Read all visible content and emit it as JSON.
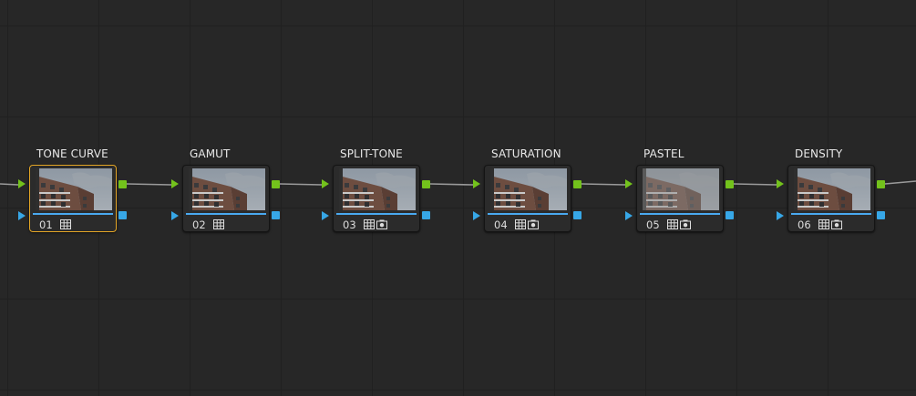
{
  "nodes": [
    {
      "label": "TONE CURVE",
      "number": "01",
      "icons": [
        "grid-icon"
      ],
      "selected": true,
      "dimmed": false
    },
    {
      "label": "GAMUT",
      "number": "02",
      "icons": [
        "grid-icon"
      ],
      "selected": false,
      "dimmed": false
    },
    {
      "label": "SPLIT-TONE",
      "number": "03",
      "icons": [
        "grid-icon",
        "camera-icon"
      ],
      "selected": false,
      "dimmed": false
    },
    {
      "label": "SATURATION",
      "number": "04",
      "icons": [
        "grid-icon",
        "camera-icon"
      ],
      "selected": false,
      "dimmed": false
    },
    {
      "label": "PASTEL",
      "number": "05",
      "icons": [
        "grid-icon",
        "camera-icon"
      ],
      "selected": false,
      "dimmed": true
    },
    {
      "label": "DENSITY",
      "number": "06",
      "icons": [
        "grid-icon",
        "camera-icon"
      ],
      "selected": false,
      "dimmed": false
    }
  ],
  "colors": {
    "selected_border": "#e3a526",
    "rgb_port": "#73c21c",
    "alpha_port": "#37a7e7",
    "progress": "#4aa9f0"
  }
}
